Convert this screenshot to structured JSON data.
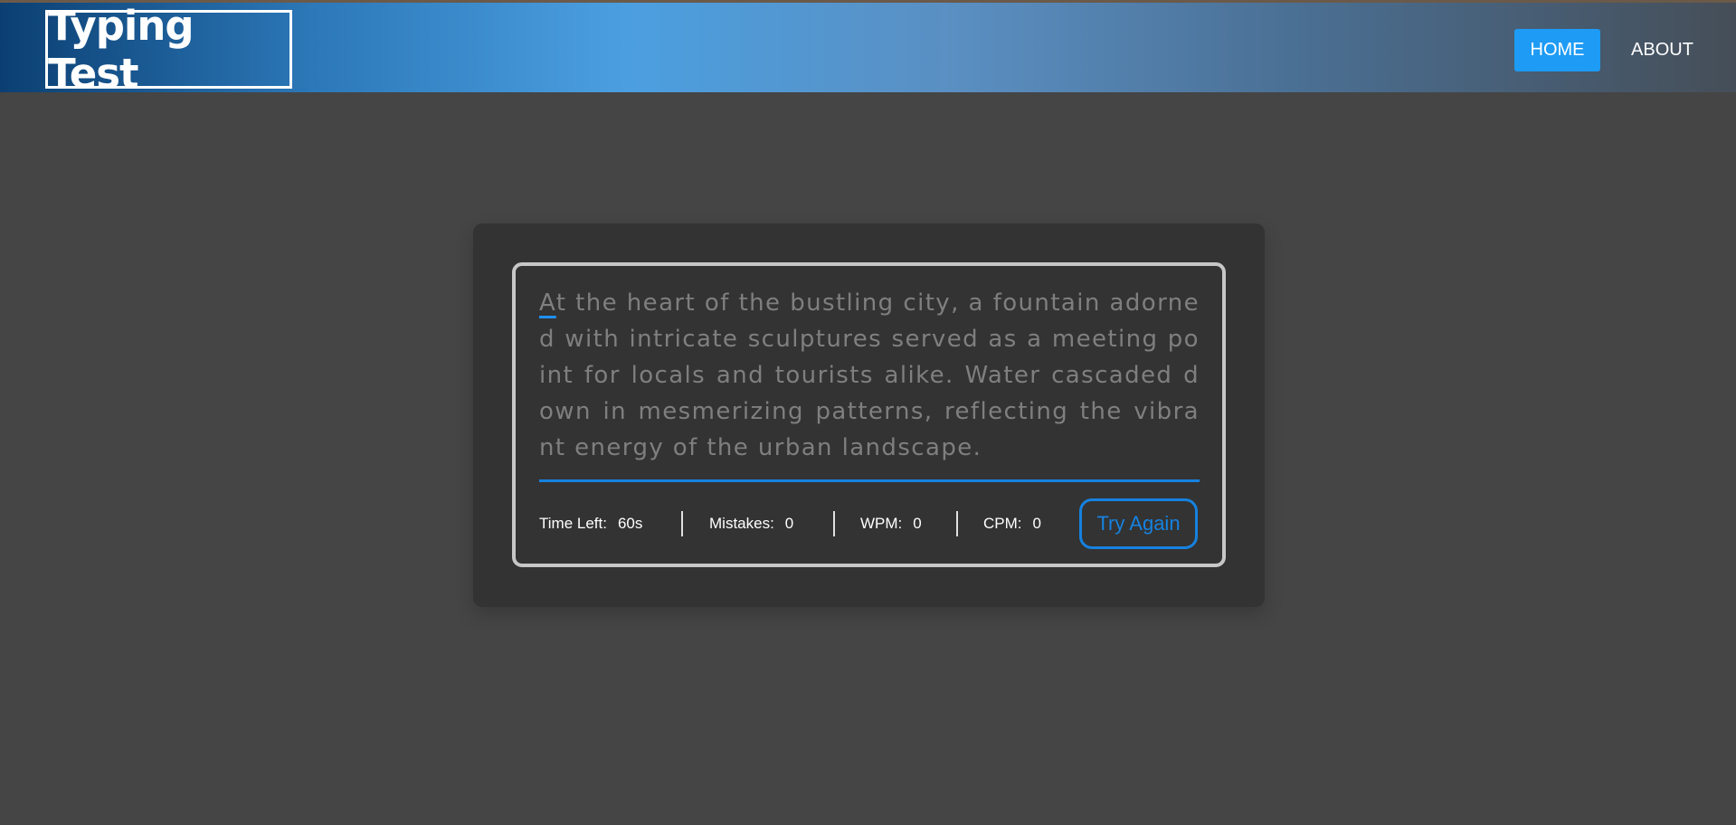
{
  "nav": {
    "logo": "Typing Test",
    "home_label": "HOME",
    "about_label": "ABOUT"
  },
  "test": {
    "first_char": "A",
    "passage_rest": "t the heart of the bustling city, a fountain adorned with intricate sculptures served as a meeting point for locals and tourists alike. Water cascaded down in mesmerizing patterns, reflecting the vibrant energy of the urban landscape.",
    "stats": {
      "time_label": "Time Left:",
      "time_value": "60s",
      "mistakes_label": "Mistakes:",
      "mistakes_value": "0",
      "wpm_label": "WPM:",
      "wpm_value": "0",
      "cpm_label": "CPM:",
      "cpm_value": "0"
    },
    "try_again_label": "Try Again"
  },
  "colors": {
    "accent": "#1682e0",
    "nav_active": "#1e9bf5",
    "background": "#454545",
    "card": "#333333"
  }
}
